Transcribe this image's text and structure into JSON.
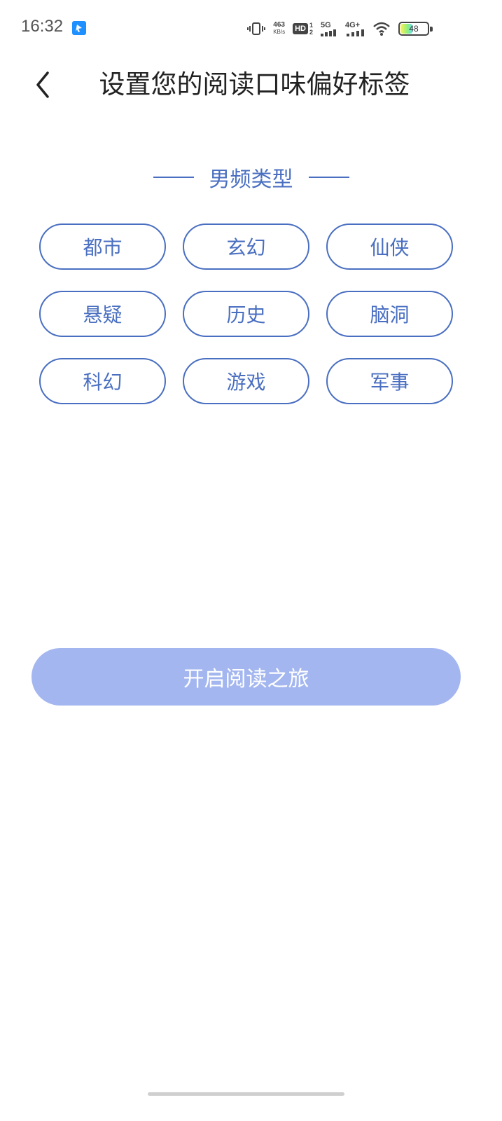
{
  "status_bar": {
    "time": "16:32",
    "app_icon": "app-notification-icon",
    "net_speed_value": "463",
    "net_speed_unit": "KB/s",
    "hd_label": "HD",
    "hd_sim_1": "1",
    "hd_sim_2": "2",
    "signal_1_label": "5G",
    "signal_2_label": "4G+",
    "battery_level": "48",
    "icons": [
      "vibrate-icon",
      "signal-5g-icon",
      "signal-4g-icon",
      "wifi-icon",
      "battery-icon"
    ]
  },
  "header": {
    "back_icon": "chevron-left-icon",
    "title": "设置您的阅读口味偏好标签"
  },
  "section": {
    "title": "男频类型",
    "tags": [
      "都市",
      "玄幻",
      "仙侠",
      "悬疑",
      "历史",
      "脑洞",
      "科幻",
      "游戏",
      "军事"
    ]
  },
  "start_button": {
    "label": "开启阅读之旅"
  },
  "colors": {
    "accent": "#4a6fc1",
    "button_disabled": "#a3b6ef",
    "title_text": "#222222"
  }
}
